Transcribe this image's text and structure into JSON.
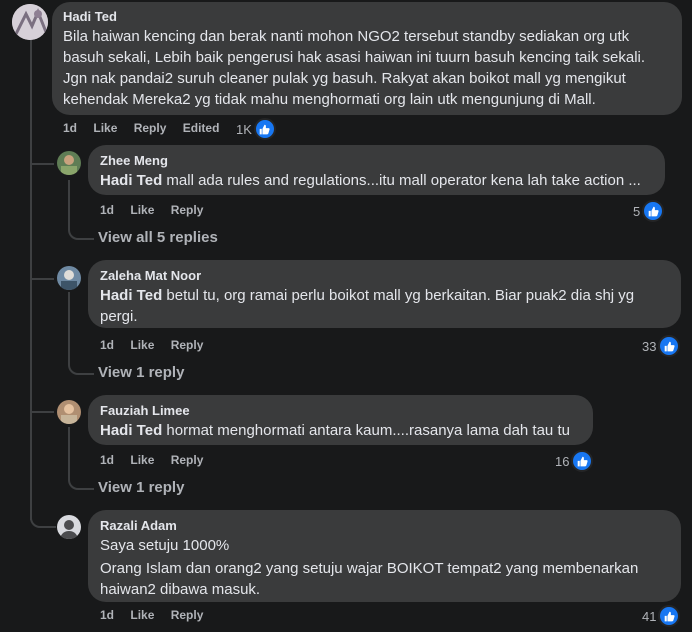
{
  "comments": [
    {
      "author": "Hadi Ted",
      "text": "Bila haiwan kencing dan berak nanti mohon NGO2 tersebut standby sediakan org utk basuh sekali, Lebih baik pengerusi hak asasi haiwan ini tuurn basuh kencing taik sekali. Jgn nak pandai2 suruh cleaner pulak yg basuh. Rakyat akan boikot mall yg mengikut kehendak Mereka2 yg tidak mahu menghormati org lain utk mengunjung di Mall.",
      "time": "1d",
      "like_label": "Like",
      "reply_label": "Reply",
      "edited_label": "Edited",
      "reactions": "1K",
      "replies": [
        {
          "author": "Zhee Meng",
          "mention": "Hadi Ted",
          "text": "mall ada rules and regulations...itu mall operator kena lah take action ...",
          "time": "1d",
          "like_label": "Like",
          "reply_label": "Reply",
          "reactions": "5",
          "view_replies": "View all 5 replies"
        },
        {
          "author": "Zaleha Mat Noor",
          "mention": "Hadi Ted",
          "text": "betul tu, org ramai perlu boikot mall yg berkaitan. Biar puak2 dia shj yg pergi.",
          "time": "1d",
          "like_label": "Like",
          "reply_label": "Reply",
          "reactions": "33",
          "view_replies": "View 1 reply"
        },
        {
          "author": "Fauziah Limee",
          "mention": "Hadi Ted",
          "text": "hormat menghormati antara kaum....rasanya lama dah tau tu",
          "time": "1d",
          "like_label": "Like",
          "reply_label": "Reply",
          "reactions": "16",
          "view_replies": "View 1 reply"
        },
        {
          "author": "Razali Adam",
          "line1": "Saya setuju 1000%",
          "line2": "Orang Islam dan orang2 yang setuju wajar BOIKOT tempat2 yang membenarkan haiwan2 dibawa masuk.",
          "time": "1d",
          "like_label": "Like",
          "reply_label": "Reply",
          "reactions": "41"
        }
      ]
    }
  ],
  "colors": {
    "bg": "#18191a",
    "bubble": "#3a3b3c",
    "like_blue": "#1877f2",
    "muted": "#b0b3b8"
  },
  "icons": [
    "like-icon",
    "avatar"
  ]
}
